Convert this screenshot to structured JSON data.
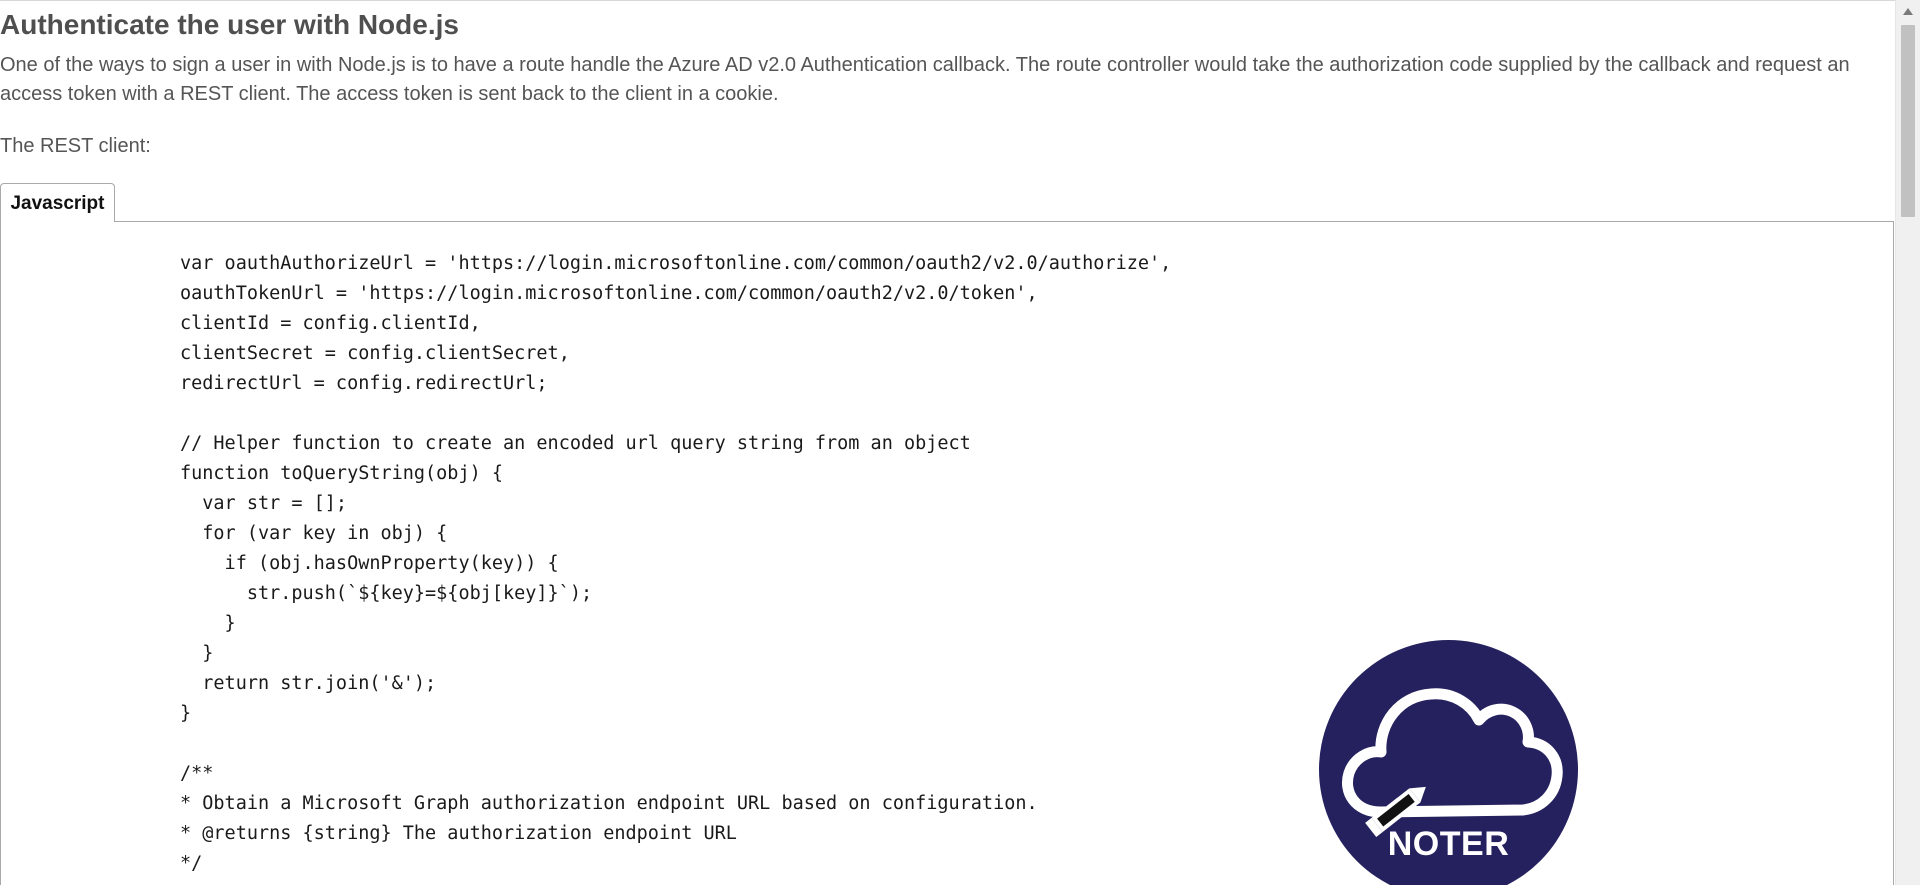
{
  "article": {
    "title": "Authenticate the user with Node.js",
    "intro": "One of the ways to sign a user in with Node.js is to have a route handle the Azure AD v2.0 Authentication callback. The route controller would take the authorization code supplied by the callback and request an access token with a REST client. The access token is sent back to the client in a cookie.",
    "rest_label": "The REST client:"
  },
  "code_tabs": [
    {
      "label": "Javascript",
      "selected": true
    }
  ],
  "code": {
    "lines": [
      "var oauthAuthorizeUrl = 'https://login.microsoftonline.com/common/oauth2/v2.0/authorize',",
      "oauthTokenUrl = 'https://login.microsoftonline.com/common/oauth2/v2.0/token',",
      "clientId = config.clientId,",
      "clientSecret = config.clientSecret,",
      "redirectUrl = config.redirectUrl;",
      "",
      "// Helper function to create an encoded url query string from an object",
      "function toQueryString(obj) {",
      "  var str = [];",
      "  for (var key in obj) {",
      "    if (obj.hasOwnProperty(key)) {",
      "      str.push(`${key}=${obj[key]}`);",
      "    }",
      "  }",
      "  return str.join('&');",
      "}",
      "",
      "/**",
      "* Obtain a Microsoft Graph authorization endpoint URL based on configuration.",
      "* @returns {string} The authorization endpoint URL",
      "*/"
    ]
  },
  "watermark": {
    "text": "NOTER",
    "icon": "cloud-pencil-icon",
    "background_color": "#24215e"
  },
  "scrollbar": {
    "up_icon": "chevron-up-icon"
  }
}
